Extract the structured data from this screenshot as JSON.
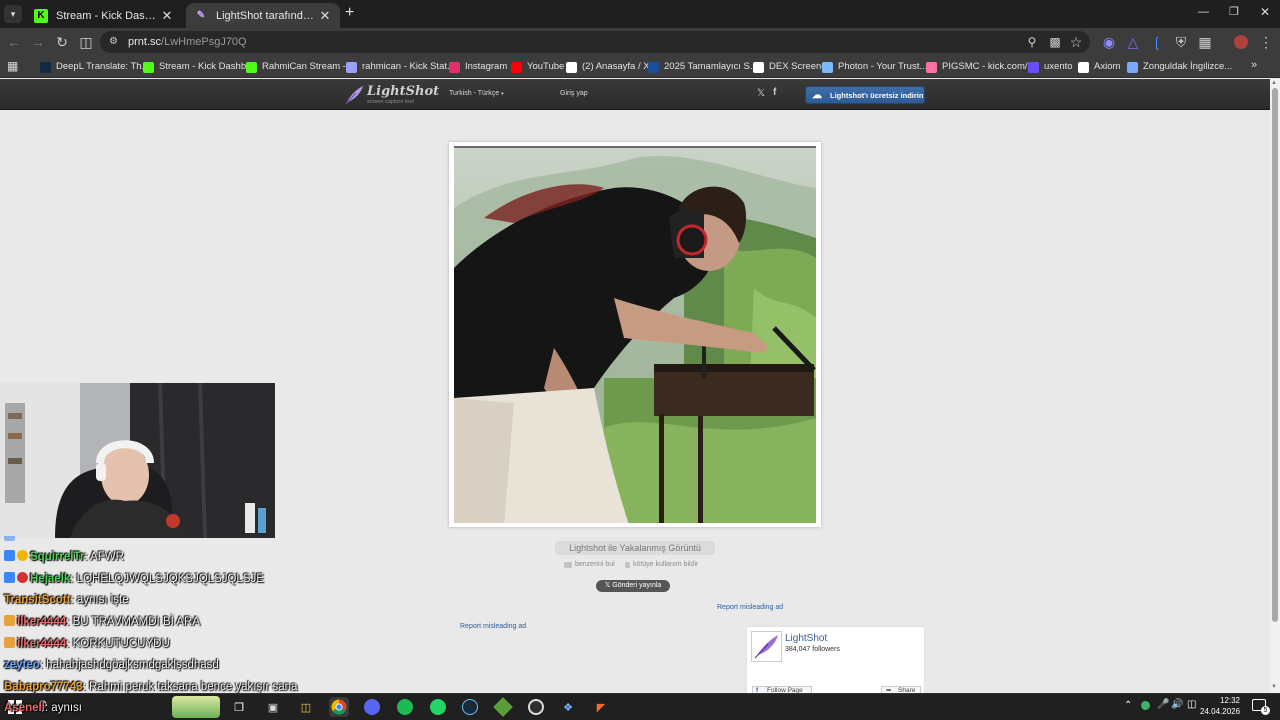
{
  "browser": {
    "tabs": [
      {
        "label": "Stream - Kick Dashboard",
        "favicon": "kick-icon",
        "active": false
      },
      {
        "label": "LightShot tarafından Ekran Görüntüsü",
        "favicon": "lightshot-icon",
        "active": true
      }
    ],
    "new_tab": "+",
    "url_host": "prnt.sc",
    "url_path": "/LwHmePsgJ70Q",
    "bookmarks": [
      {
        "label": "DeepL Translate: Th...",
        "icon": "deepl-icon",
        "color": "#0f2b46"
      },
      {
        "label": "Stream - Kick Dashb...",
        "icon": "kick-icon",
        "color": "#53fc18"
      },
      {
        "label": "RahmiCan Stream -...",
        "icon": "kick-icon",
        "color": "#53fc18"
      },
      {
        "label": "rahmican - Kick Stat...",
        "icon": "kickstats-icon",
        "color": "#9aa0ff"
      },
      {
        "label": "Instagram",
        "icon": "instagram-icon",
        "color": "#e1306c"
      },
      {
        "label": "YouTube",
        "icon": "youtube-icon",
        "color": "#ff0000"
      },
      {
        "label": "(2) Anasayfa / X",
        "icon": "x-icon",
        "color": "#ffffff"
      },
      {
        "label": "2025 Tamamlayıcı S...",
        "icon": "osym-icon",
        "color": "#1b4d9c"
      },
      {
        "label": "DEX Screener",
        "icon": "dex-icon",
        "color": "#ffffff"
      },
      {
        "label": "Photon - Your Trust...",
        "icon": "photon-icon",
        "color": "#7ab8ff"
      },
      {
        "label": "PIGSMC - kick.com/...",
        "icon": "pig-icon",
        "color": "#ff6fa8"
      },
      {
        "label": "uxento",
        "icon": "uxento-icon",
        "color": "#6b4cff"
      },
      {
        "label": "Axiom",
        "icon": "axiom-icon",
        "color": "#ffffff"
      },
      {
        "label": "Zonguldak İngilizce...",
        "icon": "dictionary-icon",
        "color": "#7aa7ff"
      }
    ]
  },
  "lightshot": {
    "logo_name": "LightShot",
    "logo_tagline": "screen capture tool",
    "language": "Turkish - Türkçe",
    "login": "Giriş yap",
    "download_button": "Lightshot'ı ücretsiz indirin",
    "caption": "Lightshot ile Yakalanmış Görüntü",
    "find_similar": "benzerini bul",
    "report_abuse": "kötüye kullanım bildir",
    "post_button": "Gönderi yayınla",
    "report_ad_1": "Report misleading ad",
    "report_ad_2": "Report misleading ad",
    "fb": {
      "page_name": "LightShot",
      "followers": "384,047 followers",
      "follow_button": "Follow Page",
      "share_button": "Share"
    }
  },
  "chat": [
    {
      "user": "SquirrelTr",
      "message": ": AFWR",
      "color": "#53d05a"
    },
    {
      "user": "Hejaelk",
      "message": ": LQHELQJWQLSJQKSJQLSJQLSJE",
      "color": "#53d05a"
    },
    {
      "user": "TransitScott",
      "message": ": aynısı işte",
      "color": "#e8a23a"
    },
    {
      "user": "ilker4444",
      "message": ": BU TRAVMAMDI Bİ ARA",
      "color": "#e86a6a"
    },
    {
      "user": "ilker4444",
      "message": ": KORKUTUCUYDU",
      "color": "#e86a6a"
    },
    {
      "user": "zeyteo",
      "message": ": hahahjashdgöajksmdgaklşsdhasd",
      "color": "#6aa8ff"
    },
    {
      "user": "Babapro77743",
      "message": ": Rahmi peruk taksana bence yakışır sana",
      "color": "#e8a23a"
    },
    {
      "user": "Asenell",
      "message": ": aynısı",
      "color": "#e86a6a"
    }
  ],
  "taskbar": {
    "time": "12:32",
    "date": "24.04.2026",
    "notification_count": "5"
  }
}
